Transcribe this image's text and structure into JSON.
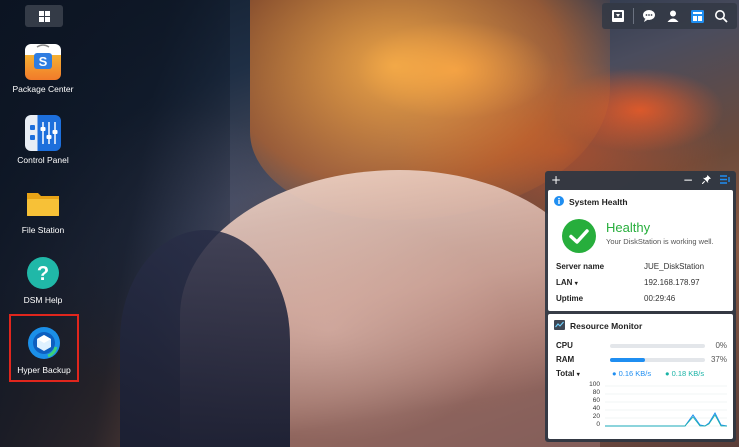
{
  "topbar": {
    "icons": [
      "main-menu-icon",
      "download-icon",
      "chat-icon",
      "user-icon",
      "widgets-icon",
      "search-icon"
    ]
  },
  "desktop": {
    "icons": [
      {
        "label": "Package Center",
        "icon": "package-center-icon"
      },
      {
        "label": "Control Panel",
        "icon": "control-panel-icon"
      },
      {
        "label": "File Station",
        "icon": "file-station-icon"
      },
      {
        "label": "DSM Help",
        "icon": "help-icon"
      },
      {
        "label": "Hyper Backup",
        "icon": "hyper-backup-icon"
      }
    ]
  },
  "widgets": {
    "header_controls": {
      "add": "+",
      "minimize": "−"
    },
    "system_health": {
      "title": "System Health",
      "status": "Healthy",
      "message": "Your DiskStation is working well.",
      "server_name_label": "Server name",
      "server_name": "JUE_DiskStation",
      "lan_label": "LAN",
      "lan_value": "192.168.178.97",
      "uptime_label": "Uptime",
      "uptime_value": "00:29:46"
    },
    "resource_monitor": {
      "title": "Resource Monitor",
      "cpu_label": "CPU",
      "cpu_value": "0%",
      "cpu_percent": 0,
      "ram_label": "RAM",
      "ram_value": "37%",
      "ram_percent": 37,
      "total_label": "Total",
      "upload": "0.16 KB/s",
      "download": "0.18 KB/s",
      "y_ticks": [
        "100",
        "80",
        "60",
        "40",
        "20",
        "0"
      ]
    }
  },
  "colors": {
    "accent": "#1f8ef1",
    "healthy": "#27ae3c",
    "upload_dot": "#1f8ef1",
    "download_dot": "#1ab3a6",
    "highlight": "#e0261d"
  }
}
